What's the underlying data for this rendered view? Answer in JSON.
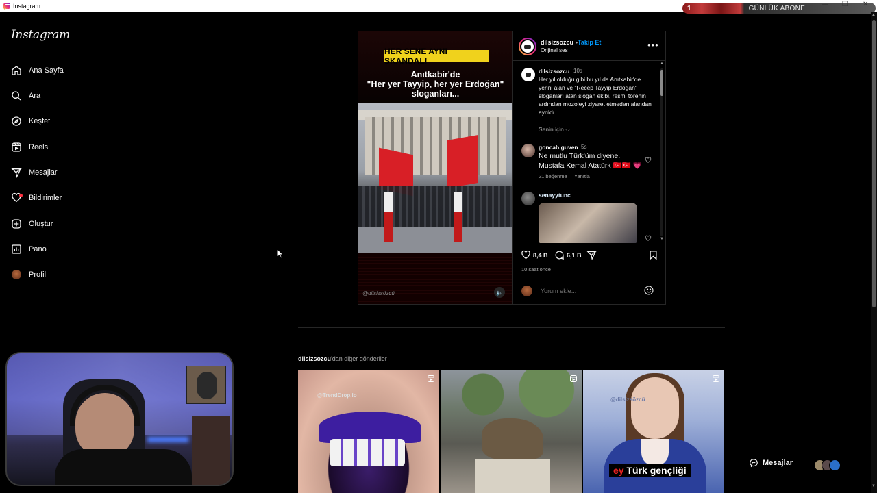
{
  "window": {
    "title": "Instagram",
    "overlay_number": "1",
    "overlay_label": "GÜNLÜK ABONE"
  },
  "sidebar": {
    "logo": "Instagram",
    "items": [
      {
        "label": "Ana Sayfa",
        "icon": "home-icon"
      },
      {
        "label": "Ara",
        "icon": "search-icon"
      },
      {
        "label": "Keşfet",
        "icon": "compass-icon"
      },
      {
        "label": "Reels",
        "icon": "reels-icon"
      },
      {
        "label": "Mesajlar",
        "icon": "send-icon"
      },
      {
        "label": "Bildirimler",
        "icon": "heart-icon"
      },
      {
        "label": "Oluştur",
        "icon": "plus-square-icon"
      },
      {
        "label": "Pano",
        "icon": "dashboard-icon"
      },
      {
        "label": "Profil",
        "icon": "avatar"
      }
    ]
  },
  "post": {
    "media": {
      "banner": "HER SENE AYNI SKANDAL!",
      "headline_line1": "Anıtkabir'de",
      "headline_line2": "\"Her yer Tayyip, her yer Erdoğan\"",
      "headline_line3": "sloganları...",
      "watermark": "@dilsizsözcü"
    },
    "header": {
      "username": "dilsizsozcu",
      "separator": "•",
      "follow_label": "Takip Et",
      "audio": "Orijinal ses"
    },
    "caption": {
      "username": "dilsizsozcu",
      "time": "10s",
      "text": "Her yıl olduğu gibi bu yıl da Anıtkabir'de yerini alan ve \"Recep Tayyip Erdoğan\" sloganları atan slogan ekibi, resmi törenin ardından mozoleyi ziyaret etmeden alandan ayrıldı.",
      "filter_label": "Senin için"
    },
    "comments": [
      {
        "username": "goncab.guven",
        "time": "5s",
        "text_line1": "Ne mutlu Türk'üm diyene.",
        "text_line2": "Mustafa Kemal Atatürk 🇹🇷🇹🇷",
        "heart": "💗",
        "likes": "21 beğenme",
        "reply": "Yanıtla"
      },
      {
        "username": "senayytunc"
      }
    ],
    "actions": {
      "likes": "8,4 B",
      "comments": "6,1 B",
      "posted_ago": "10 saat önce"
    },
    "add_comment_placeholder": "Yorum ekle..."
  },
  "more_posts": {
    "username": "dilsizsozcu",
    "suffix": "'dan diğer gönderiler",
    "tiles": [
      {
        "watermark": "@TrendDrop.io"
      },
      {
        "watermark": ""
      },
      {
        "watermark": "@dilsizsözcü",
        "caption_red": "ey",
        "caption": " Türk gençliği"
      }
    ]
  },
  "messages_button": "Mesajlar"
}
